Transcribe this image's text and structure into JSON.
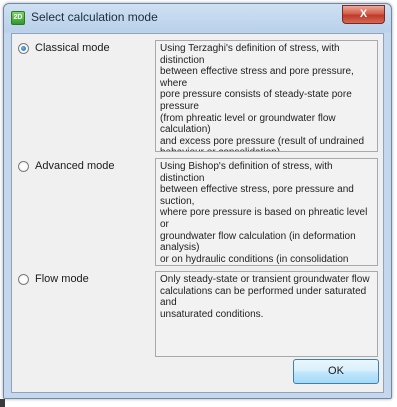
{
  "window": {
    "title": "Select calculation mode",
    "app_icon_text": "2D",
    "close_label": "X"
  },
  "modes": [
    {
      "label": "Classical mode",
      "selected": true,
      "description": "Using Terzaghi's definition of stress, with distinction\nbetween effective stress and pore pressure, where\npore pressure consists of steady-state pore pressure\n(from phreatic level or groundwater flow calculation)\nand excess pore pressure (result of undrained\nbehaviour or consolidation).\nIn Classical mode, consolidation is based on excess\npore pressure considering saturated conditions."
    },
    {
      "label": "Advanced mode",
      "selected": false,
      "description": "Using Bishop's definition of stress, with distinction\nbetween effective stress, pore pressure and suction,\nwhere pore pressure is based on phreatic level or\ngroundwater flow calculation (in deformation analysis)\n or on hydraulic conditions (in consolidation analysis).\nIn Advanced mode, consolidation is based on total\npore pressure with special consideration of the\nunsaturated zone."
    },
    {
      "label": "Flow mode",
      "selected": false,
      "description": "Only steady-state or transient groundwater flow\ncalculations can be performed under saturated and\nunsaturated conditions."
    }
  ],
  "buttons": {
    "ok_label": "OK"
  }
}
